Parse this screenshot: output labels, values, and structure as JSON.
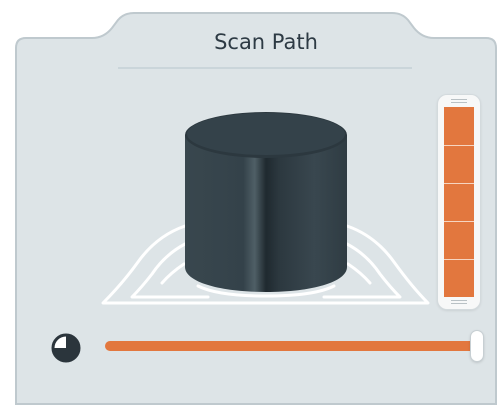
{
  "panel": {
    "title": "Scan Path"
  },
  "icons": {
    "cylinder": "cylinder-object",
    "platform": "scan-platform-outline",
    "progress": "pie-clock-icon"
  },
  "vertical_meter": {
    "fill_fraction": 1.0,
    "segments": 5
  },
  "scan_slider": {
    "fraction": 1.0
  },
  "colors": {
    "accent": "#E2773E",
    "panel_background": "#DDE4E7",
    "panel_border": "#BFC9CE",
    "object_dark": "#34434A",
    "title_text": "#2D3A44"
  }
}
